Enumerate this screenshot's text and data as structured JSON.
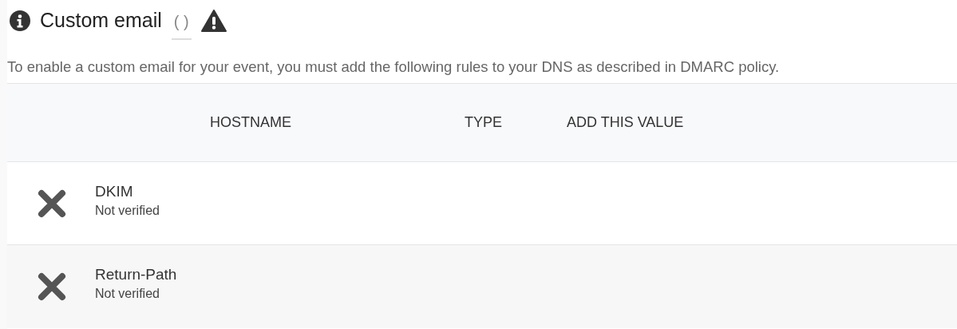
{
  "heading": {
    "title": "Custom email",
    "count": "( )"
  },
  "description": "To enable a custom email for your event, you must add the following rules to your DNS as described in DMARC policy.",
  "table": {
    "columns": [
      "HOSTNAME",
      "TYPE",
      "ADD THIS VALUE"
    ],
    "rows": [
      {
        "name": "DKIM",
        "status": "Not verified",
        "verified": false
      },
      {
        "name": "Return-Path",
        "status": "Not verified",
        "verified": false
      }
    ]
  }
}
